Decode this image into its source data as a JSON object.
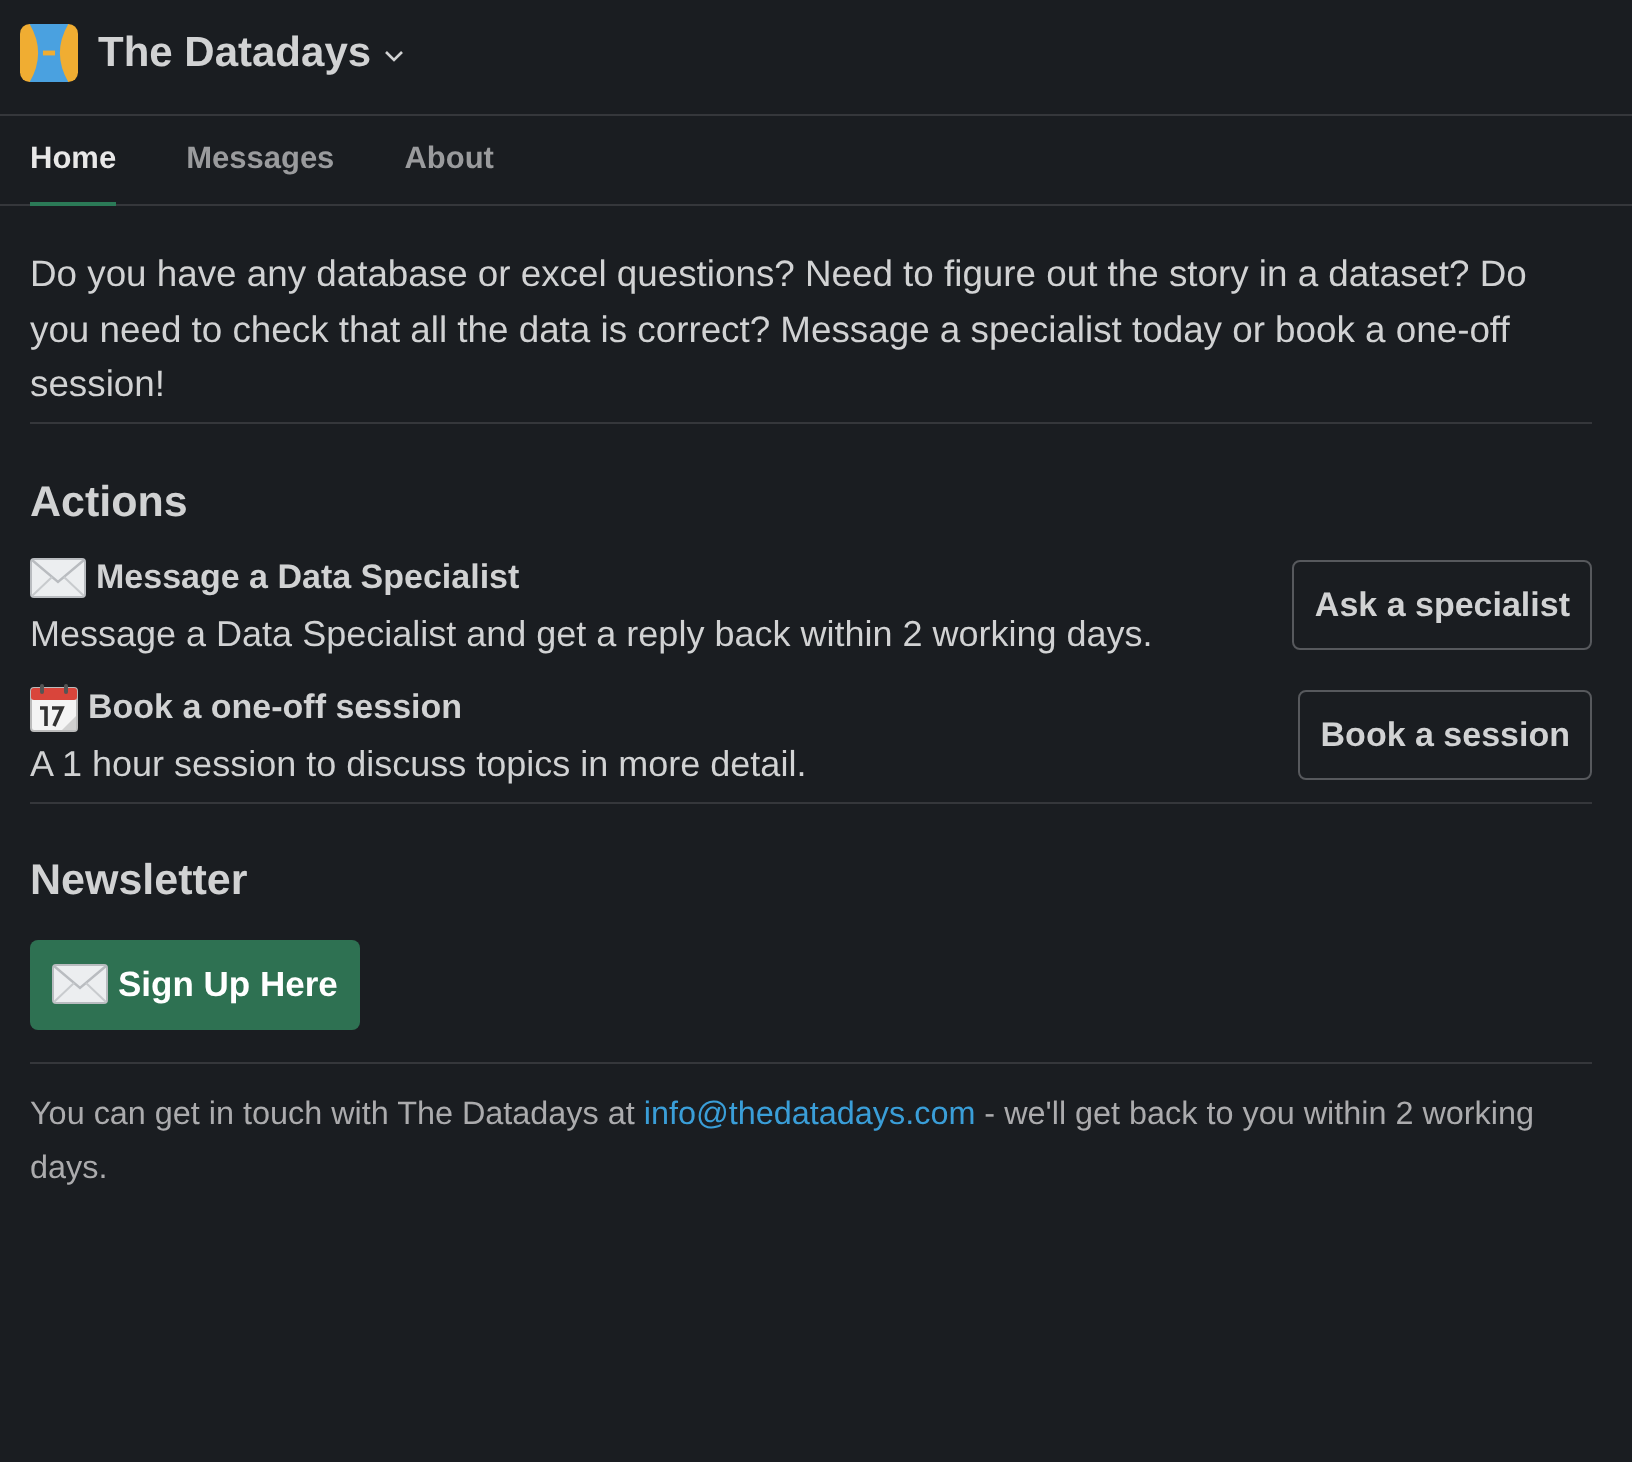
{
  "header": {
    "title": "The Datadays"
  },
  "tabs": [
    {
      "label": "Home",
      "selected": true
    },
    {
      "label": "Messages",
      "selected": false
    },
    {
      "label": "About",
      "selected": false
    }
  ],
  "intro": "Do you have any database or excel questions? Need to figure out the story in a dataset? Do you need to check that all the data is correct? Message a specialist today or book a one-off session!",
  "actions": {
    "heading": "Actions",
    "items": [
      {
        "kind": "envelope",
        "title": "Message a Data Specialist",
        "description": "Message a Data Specialist and get a reply back within 2 working days.",
        "button": "Ask a specialist"
      },
      {
        "kind": "calendar",
        "title": "Book a one-off session",
        "description": "A 1 hour session to discuss topics in more detail.",
        "button": "Book a session"
      }
    ]
  },
  "newsletter": {
    "heading": "Newsletter",
    "button": "Sign Up Here"
  },
  "footer": {
    "before": "You can get in touch with The Datadays at",
    "link": "info@thedatadays.com",
    "after": "- we'll get back to you within 2 working days."
  }
}
